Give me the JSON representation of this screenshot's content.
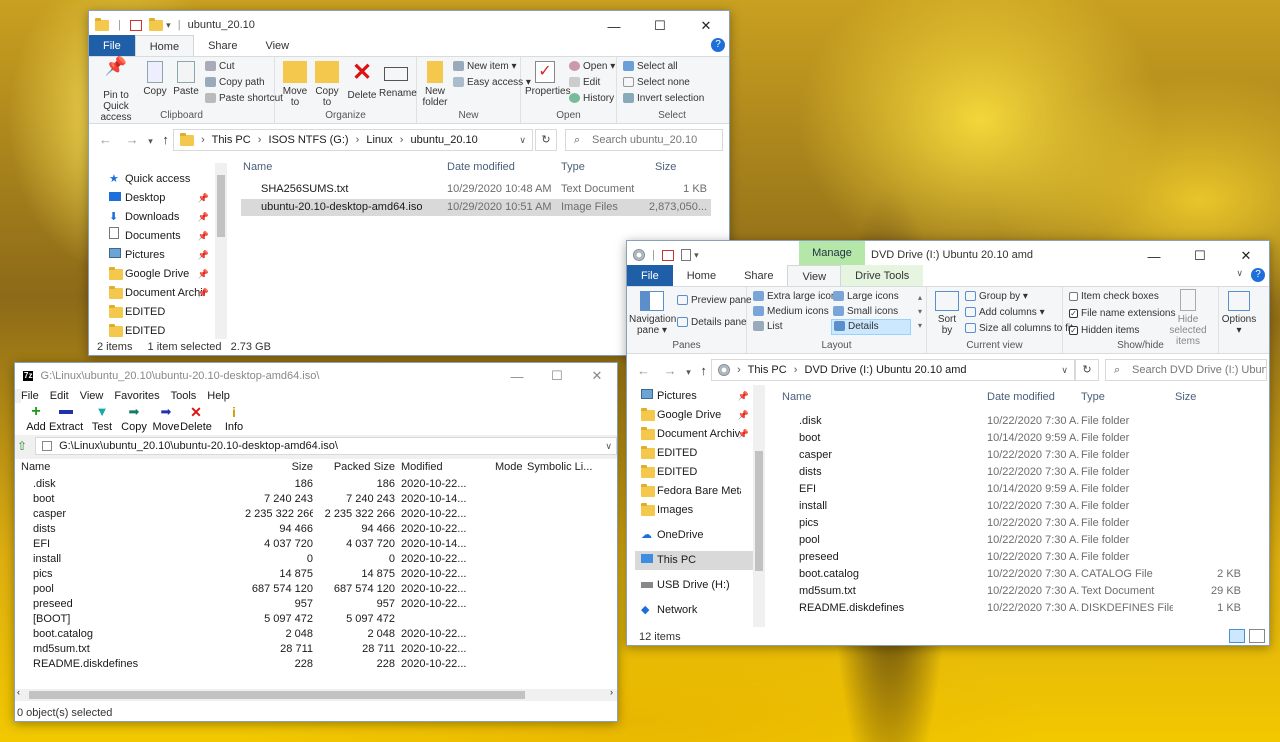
{
  "win1": {
    "title": "ubuntu_20.10",
    "tabs": [
      "File",
      "Home",
      "Share",
      "View"
    ],
    "ribbon": {
      "clipboard": {
        "label": "Clipboard",
        "pin": "Pin to Quick access",
        "copy": "Copy",
        "paste": "Paste",
        "cut": "Cut",
        "copy_path": "Copy path",
        "paste_shortcut": "Paste shortcut"
      },
      "organize": {
        "label": "Organize",
        "move_to": "Move to",
        "copy_to": "Copy to",
        "delete": "Delete",
        "rename": "Rename"
      },
      "new": {
        "label": "New",
        "new_folder": "New folder",
        "new_item": "New item",
        "easy_access": "Easy access"
      },
      "open": {
        "label": "Open",
        "properties": "Properties",
        "open": "Open",
        "edit": "Edit",
        "history": "History"
      },
      "select": {
        "label": "Select",
        "select_all": "Select all",
        "select_none": "Select none",
        "invert": "Invert selection"
      }
    },
    "address": [
      "This PC",
      "ISOS NTFS (G:)",
      "Linux",
      "ubuntu_20.10"
    ],
    "search_placeholder": "Search ubuntu_20.10",
    "nav": [
      {
        "label": "Quick access",
        "icon": "star-icon",
        "pin": false
      },
      {
        "label": "Desktop",
        "icon": "desktop-icon",
        "pin": true
      },
      {
        "label": "Downloads",
        "icon": "download-icon",
        "pin": true
      },
      {
        "label": "Documents",
        "icon": "documents-icon",
        "pin": true
      },
      {
        "label": "Pictures",
        "icon": "pictures-icon",
        "pin": true
      },
      {
        "label": "Google Drive",
        "icon": "folder-icon",
        "pin": true
      },
      {
        "label": "Document Archiv",
        "icon": "folder-icon",
        "pin": true
      },
      {
        "label": "EDITED",
        "icon": "folder-icon",
        "pin": false
      },
      {
        "label": "EDITED",
        "icon": "folder-icon",
        "pin": false
      }
    ],
    "columns": {
      "name": "Name",
      "date": "Date modified",
      "type": "Type",
      "size": "Size"
    },
    "files": [
      {
        "name": "SHA256SUMS.txt",
        "date": "10/29/2020 10:48 AM",
        "type": "Text Document",
        "size": "1 KB",
        "icon": "text-file-icon"
      },
      {
        "name": "ubuntu-20.10-desktop-amd64.iso",
        "date": "10/29/2020 10:51 AM",
        "type": "Image Files",
        "size": "2,873,050...",
        "icon": "iso-file-icon",
        "selected": true
      }
    ],
    "status": {
      "items": "2 items",
      "selected": "1 item selected",
      "size": "2.73 GB"
    }
  },
  "win2": {
    "title": "G:\\Linux\\ubuntu_20.10\\ubuntu-20.10-desktop-amd64.iso\\",
    "menu": [
      "File",
      "Edit",
      "View",
      "Favorites",
      "Tools",
      "Help"
    ],
    "tools": [
      "Add",
      "Extract",
      "Test",
      "Copy",
      "Move",
      "Delete",
      "Info"
    ],
    "path": "G:\\Linux\\ubuntu_20.10\\ubuntu-20.10-desktop-amd64.iso\\",
    "columns": {
      "name": "Name",
      "size": "Size",
      "packed": "Packed Size",
      "modified": "Modified",
      "mode": "Mode",
      "symlink": "Symbolic Li..."
    },
    "rows": [
      {
        "name": ".disk",
        "size": "186",
        "packed": "186",
        "modified": "2020-10-22...",
        "folder": true
      },
      {
        "name": "boot",
        "size": "7 240 243",
        "packed": "7 240 243",
        "modified": "2020-10-14...",
        "folder": true
      },
      {
        "name": "casper",
        "size": "2 235 322 266",
        "packed": "2 235 322 266",
        "modified": "2020-10-22...",
        "folder": true
      },
      {
        "name": "dists",
        "size": "94 466",
        "packed": "94 466",
        "modified": "2020-10-22...",
        "folder": true
      },
      {
        "name": "EFI",
        "size": "4 037 720",
        "packed": "4 037 720",
        "modified": "2020-10-14...",
        "folder": true
      },
      {
        "name": "install",
        "size": "0",
        "packed": "0",
        "modified": "2020-10-22...",
        "folder": true
      },
      {
        "name": "pics",
        "size": "14 875",
        "packed": "14 875",
        "modified": "2020-10-22...",
        "folder": true
      },
      {
        "name": "pool",
        "size": "687 574 120",
        "packed": "687 574 120",
        "modified": "2020-10-22...",
        "folder": true
      },
      {
        "name": "preseed",
        "size": "957",
        "packed": "957",
        "modified": "2020-10-22...",
        "folder": true
      },
      {
        "name": "[BOOT]",
        "size": "5 097 472",
        "packed": "5 097 472",
        "modified": "",
        "folder": true
      },
      {
        "name": "boot.catalog",
        "size": "2 048",
        "packed": "2 048",
        "modified": "2020-10-22...",
        "folder": false
      },
      {
        "name": "md5sum.txt",
        "size": "28 711",
        "packed": "28 711",
        "modified": "2020-10-22...",
        "folder": false
      },
      {
        "name": "README.diskdefines",
        "size": "228",
        "packed": "228",
        "modified": "2020-10-22...",
        "folder": false
      }
    ],
    "status": "0 object(s) selected"
  },
  "win3": {
    "title": "DVD Drive (I:) Ubuntu 20.10 amd",
    "manage": "Manage",
    "tabs": [
      "File",
      "Home",
      "Share",
      "View",
      "Drive Tools"
    ],
    "ribbon": {
      "panes": {
        "label": "Panes",
        "nav": "Navigation pane",
        "preview": "Preview pane",
        "details": "Details pane"
      },
      "layout": {
        "label": "Layout",
        "items": [
          "Extra large icons",
          "Large icons",
          "Medium icons",
          "Small icons",
          "List",
          "Details"
        ]
      },
      "current": {
        "label": "Current view",
        "sort": "Sort by",
        "group": "Group by",
        "add_cols": "Add columns",
        "size_cols": "Size all columns to fit"
      },
      "showhide": {
        "label": "Show/hide",
        "check": "Item check boxes",
        "ext": "File name extensions",
        "hidden": "Hidden items",
        "hide_sel": "Hide selected items",
        "options": "Options"
      }
    },
    "address": [
      "This PC",
      "DVD Drive (I:) Ubuntu 20.10 amd"
    ],
    "search_placeholder": "Search DVD Drive (I:) Ubuntu...",
    "nav": [
      {
        "label": "Pictures",
        "icon": "pictures-icon",
        "pin": true
      },
      {
        "label": "Google Drive",
        "icon": "folder-icon",
        "pin": true
      },
      {
        "label": "Document Archiv",
        "icon": "folder-icon",
        "pin": true
      },
      {
        "label": "EDITED",
        "icon": "folder-icon",
        "pin": false
      },
      {
        "label": "EDITED",
        "icon": "folder-icon",
        "pin": false
      },
      {
        "label": "Fedora Bare Metal",
        "icon": "folder-icon",
        "pin": false
      },
      {
        "label": "Images",
        "icon": "folder-icon",
        "pin": false
      },
      {
        "label": "OneDrive",
        "icon": "cloud-icon",
        "pin": false
      },
      {
        "label": "This PC",
        "icon": "pc-icon",
        "pin": false,
        "selected": true
      },
      {
        "label": "USB Drive (H:)",
        "icon": "usb-drive-icon",
        "pin": false
      },
      {
        "label": "Network",
        "icon": "network-icon",
        "pin": false
      }
    ],
    "columns": {
      "name": "Name",
      "date": "Date modified",
      "type": "Type",
      "size": "Size"
    },
    "files": [
      {
        "name": ".disk",
        "date": "10/22/2020 7:30 A...",
        "type": "File folder",
        "size": "",
        "folder": true
      },
      {
        "name": "boot",
        "date": "10/14/2020 9:59 A...",
        "type": "File folder",
        "size": "",
        "folder": true
      },
      {
        "name": "casper",
        "date": "10/22/2020 7:30 A...",
        "type": "File folder",
        "size": "",
        "folder": true
      },
      {
        "name": "dists",
        "date": "10/22/2020 7:30 A...",
        "type": "File folder",
        "size": "",
        "folder": true
      },
      {
        "name": "EFI",
        "date": "10/14/2020 9:59 A...",
        "type": "File folder",
        "size": "",
        "folder": true
      },
      {
        "name": "install",
        "date": "10/22/2020 7:30 A...",
        "type": "File folder",
        "size": "",
        "folder": true
      },
      {
        "name": "pics",
        "date": "10/22/2020 7:30 A...",
        "type": "File folder",
        "size": "",
        "folder": true
      },
      {
        "name": "pool",
        "date": "10/22/2020 7:30 A...",
        "type": "File folder",
        "size": "",
        "folder": true
      },
      {
        "name": "preseed",
        "date": "10/22/2020 7:30 A...",
        "type": "File folder",
        "size": "",
        "folder": true
      },
      {
        "name": "boot.catalog",
        "date": "10/22/2020 7:30 A...",
        "type": "CATALOG File",
        "size": "2 KB",
        "folder": false
      },
      {
        "name": "md5sum.txt",
        "date": "10/22/2020 7:30 A...",
        "type": "Text Document",
        "size": "29 KB",
        "folder": false
      },
      {
        "name": "README.diskdefines",
        "date": "10/22/2020 7:30 A...",
        "type": "DISKDEFINES File",
        "size": "1 KB",
        "folder": false
      }
    ],
    "status": "12 items"
  },
  "colors": {
    "accent": "#1f5fa8",
    "selection": "#cce8ff",
    "selected_gray": "#d9d9d9",
    "manage": "#b5e8a8"
  }
}
